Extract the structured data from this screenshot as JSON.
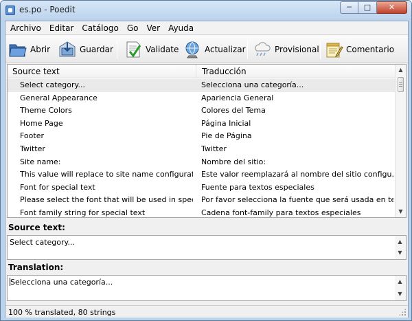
{
  "window": {
    "title": "es.po - Poedit"
  },
  "menubar": {
    "items": [
      "Archivo",
      "Editar",
      "Catálogo",
      "Go",
      "Ver",
      "Ayuda"
    ]
  },
  "toolbar": {
    "buttons": [
      {
        "label": "Abrir",
        "icon": "folder-open-icon"
      },
      {
        "label": "Guardar",
        "icon": "save-icon"
      },
      {
        "label": "Validate",
        "icon": "validate-checkmark-icon"
      },
      {
        "label": "Actualizar",
        "icon": "update-globe-icon"
      },
      {
        "label": "Provisional",
        "icon": "fuzzy-cloud-icon"
      },
      {
        "label": "Comentario",
        "icon": "comment-notepad-icon"
      }
    ]
  },
  "list": {
    "headers": {
      "source": "Source text",
      "translation": "Traducción"
    },
    "rows": [
      {
        "source": "Select category...",
        "translation": "Selecciona una categoría...",
        "selected": true
      },
      {
        "source": "General Appearance",
        "translation": "Apariencia General"
      },
      {
        "source": "Theme Colors",
        "translation": "Colores del Tema"
      },
      {
        "source": "Home Page",
        "translation": "Página Inicial"
      },
      {
        "source": "Footer",
        "translation": "Pie de Página"
      },
      {
        "source": "Twitter",
        "translation": "Twitter"
      },
      {
        "source": "Site name:",
        "translation": "Nombre del sitio:"
      },
      {
        "source": "This value will replace to site name configuratio...",
        "translation": "Este valor reemplazará al nombre del sitio configu..."
      },
      {
        "source": "Font for special text",
        "translation": "Fuente para textos especiales"
      },
      {
        "source": "Please select the font that will be used in special...",
        "translation": "Por favor selecciona la fuente que será usada en te..."
      },
      {
        "source": "Font family string for special text",
        "translation": "Cadena font-family para textos especiales"
      }
    ]
  },
  "source_panel": {
    "label": "Source text:",
    "text": "Select category..."
  },
  "translation_panel": {
    "label": "Translation:",
    "text": "Selecciona una categoría..."
  },
  "status": {
    "text": "100 % translated, 80 strings"
  }
}
